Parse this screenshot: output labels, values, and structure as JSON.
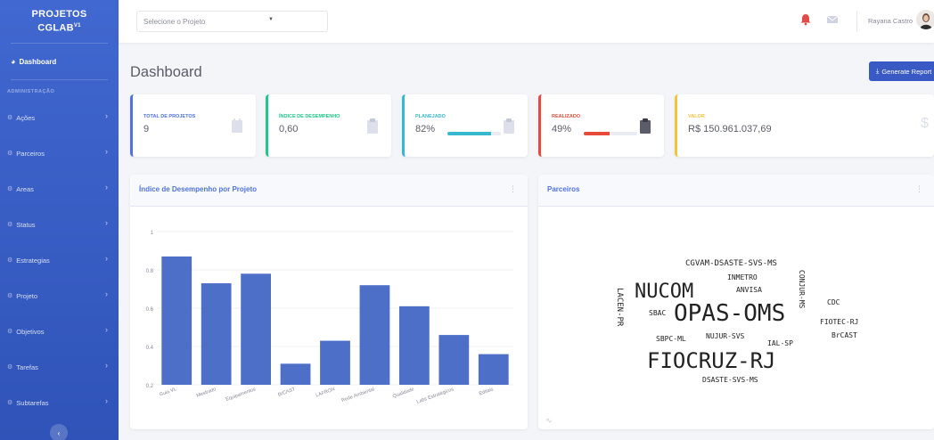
{
  "sidebar": {
    "brand_line1": "PROJETOS",
    "brand_line2": "CGLAB",
    "brand_sup": "V1",
    "dashboard_label": "Dashboard",
    "section_heading": "ADMINISTRAÇÃO",
    "items": [
      {
        "label": "Ações"
      },
      {
        "label": "Parceiros"
      },
      {
        "label": "Areas"
      },
      {
        "label": "Status"
      },
      {
        "label": "Estrategias"
      },
      {
        "label": "Projeto"
      },
      {
        "label": "Objetivos"
      },
      {
        "label": "Tarefas"
      },
      {
        "label": "Subtarefas"
      }
    ],
    "toggle_icon": "chevron-left-icon"
  },
  "topbar": {
    "project_select_placeholder": "Selecione o Projeto",
    "alerts_badge": "",
    "messages_badge": "",
    "user_name": "Rayana Castro"
  },
  "page": {
    "title": "Dashboard",
    "report_button": "Generate Report"
  },
  "cards": [
    {
      "label": "TOTAL DE PROJETOS",
      "value": "9",
      "color": "#4e73df"
    },
    {
      "label": "ÍNDICE DE DESEMPENHO",
      "value": "0,60",
      "color": "#1cc88a"
    },
    {
      "label": "PLANEJADO",
      "value": "82%",
      "progress": 82,
      "color": "#36b9cc"
    },
    {
      "label": "REALIZADO",
      "value": "49%",
      "progress": 49,
      "color": "#e74a3b"
    },
    {
      "label": "VALOR",
      "value": "R$ 150.961.037,69",
      "color": "#f6c23e"
    }
  ],
  "bar_panel": {
    "title": "Índice de Desempenho por Projeto"
  },
  "cloud_panel": {
    "title": "Parceiros",
    "words": [
      {
        "text": "CGVAM-DSASTE-SVS-MS"
      },
      {
        "text": "INMETRO"
      },
      {
        "text": "NUCOM"
      },
      {
        "text": "ANVISA"
      },
      {
        "text": "CONJUR-MS"
      },
      {
        "text": "LACEN-PR"
      },
      {
        "text": "SBAC"
      },
      {
        "text": "OPAS-OMS"
      },
      {
        "text": "CDC"
      },
      {
        "text": "FIOTEC-RJ"
      },
      {
        "text": "SBPC-ML"
      },
      {
        "text": "NUJUR-SVS"
      },
      {
        "text": "BrCAST"
      },
      {
        "text": "IAL-SP"
      },
      {
        "text": "FIOCRUZ-RJ"
      },
      {
        "text": "DSASTE-SVS-MS"
      }
    ]
  },
  "chart_data": {
    "type": "bar",
    "title": "",
    "categories": [
      "Guia VL",
      "Mestrado",
      "Equipamentos",
      "BrCAST",
      "LAFRON",
      "Rede Ambiental",
      "Qualidade",
      "Labs Estratégicos",
      "Editais"
    ],
    "values": [
      0.87,
      0.73,
      0.78,
      0.31,
      0.43,
      0.72,
      0.61,
      0.46,
      0.36
    ],
    "ylim": [
      0.2,
      1
    ],
    "yticks": [
      "0.2",
      "0.4",
      "0.6",
      "0.8",
      "1"
    ],
    "color": "#4e6fc8",
    "grid": true,
    "legend": "none"
  }
}
